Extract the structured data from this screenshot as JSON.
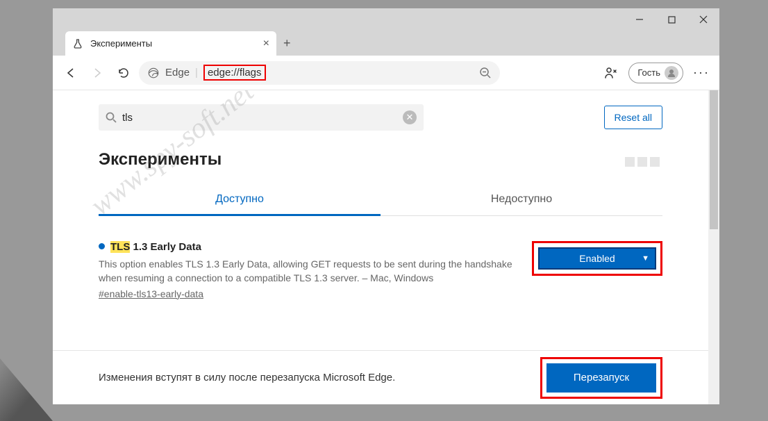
{
  "window": {
    "tab_title": "Эксперименты"
  },
  "toolbar": {
    "edge_label": "Edge",
    "url": "edge://flags",
    "profile_label": "Гость"
  },
  "page": {
    "search_value": "tls",
    "reset_label": "Reset all",
    "heading": "Эксперименты",
    "tabs": {
      "available": "Доступно",
      "unavailable": "Недоступно"
    },
    "flag": {
      "highlight": "TLS",
      "title_rest": " 1.3 Early Data",
      "description": "This option enables TLS 1.3 Early Data, allowing GET requests to be sent during the handshake when resuming a connection to a compatible TLS 1.3 server. – Mac, Windows",
      "hash": "#enable-tls13-early-data",
      "select_value": "Enabled"
    },
    "footer_text": "Изменения вступят в силу после перезапуска Microsoft Edge.",
    "restart_label": "Перезапуск"
  },
  "watermark": "www.spy-soft.net"
}
